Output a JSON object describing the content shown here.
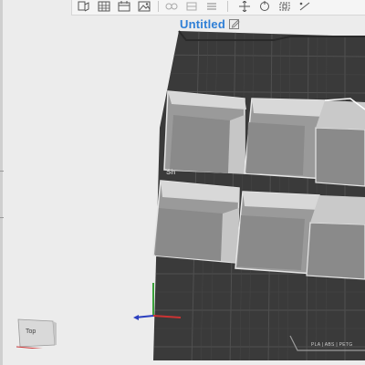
{
  "project": {
    "title": "Untitled"
  },
  "toolbar": {
    "buttons": [
      {
        "name": "add-object-icon"
      },
      {
        "name": "arrange-grid-icon"
      },
      {
        "name": "calendar-icon"
      },
      {
        "name": "image-icon"
      },
      {
        "name": "split-icon"
      },
      {
        "name": "object-icon"
      },
      {
        "name": "layers-icon"
      },
      {
        "name": "move-icon"
      },
      {
        "name": "rotate-icon"
      },
      {
        "name": "scale-icon"
      },
      {
        "name": "more-icon"
      }
    ]
  },
  "plate": {
    "filament_label": "PLA | ABS | PETG",
    "side_label": "Sh"
  },
  "view_cube": {
    "face": "Top"
  },
  "colors": {
    "accent": "#2f7fd6",
    "plate": "#3a3a3a",
    "grid": "#505050",
    "object_face": "#9a9a9a",
    "object_top": "#d8d8d8",
    "object_side": "#7e7e7e"
  }
}
